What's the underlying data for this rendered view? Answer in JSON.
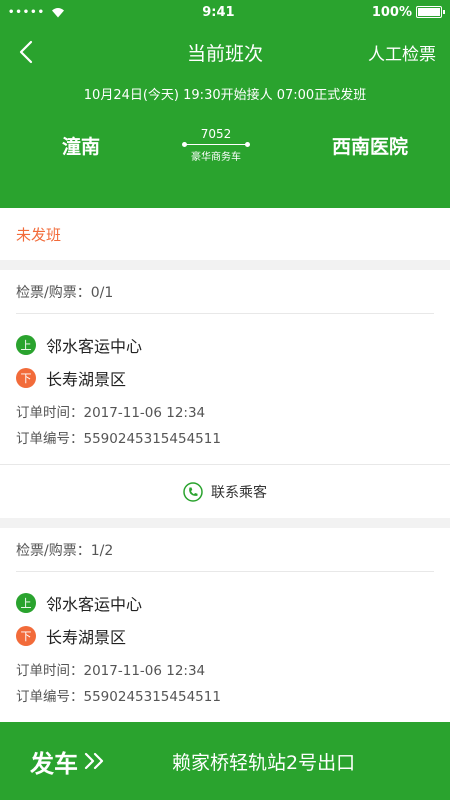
{
  "status": {
    "time": "9:41",
    "battery": "100%",
    "signal": "•••••"
  },
  "nav": {
    "title": "当前班次",
    "manual_check": "人工检票"
  },
  "schedule": {
    "text": "10月24日(今天)  19:30开始接人  07:00正式发班"
  },
  "route": {
    "from": "潼南",
    "to": "西南医院",
    "bus_no": "7052",
    "bus_type": "豪华商务车"
  },
  "state": "未发班",
  "orders": [
    {
      "check": "检票/购票：0/1",
      "board_badge": "上",
      "board": "邻水客运中心",
      "alight_badge": "下",
      "alight": "长寿湖景区",
      "time": "订单时间：2017-11-06  12:34",
      "number": "订单编号：5590245315454511",
      "contact": "联系乘客"
    },
    {
      "check": "检票/购票：1/2",
      "board_badge": "上",
      "board": "邻水客运中心",
      "alight_badge": "下",
      "alight": "长寿湖景区",
      "time": "订单时间：2017-11-06  12:34",
      "number": "订单编号：5590245315454511"
    }
  ],
  "bottom": {
    "depart": "发车",
    "station": "赖家桥轻轨站2号出口"
  },
  "colors": {
    "primary": "#2aa32e",
    "accent": "#f26b3a"
  },
  "icons": [
    "wifi-icon",
    "battery-icon",
    "back-arrow-icon",
    "phone-icon",
    "double-chevron-icon"
  ]
}
